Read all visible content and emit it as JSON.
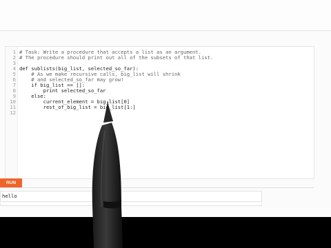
{
  "editor": {
    "lines": [
      {
        "n": "1",
        "text": "# Task: Write a procedure that accepts a list as an argument.",
        "comment": true
      },
      {
        "n": "2",
        "text": "# The procedure should print out all of the subsets of that list.",
        "comment": true
      },
      {
        "n": "3",
        "text": "",
        "comment": false
      },
      {
        "n": "4",
        "text": "def sublists(big_list, selected_so_far):",
        "comment": false
      },
      {
        "n": "5",
        "text": "    # As we make recursive calls, big_list will shrink",
        "comment": true
      },
      {
        "n": "6",
        "text": "    # and selected_so_far may grow!",
        "comment": true
      },
      {
        "n": "7",
        "text": "    if big_list == []:",
        "comment": false
      },
      {
        "n": "8",
        "text": "        print selected_so_far",
        "comment": false
      },
      {
        "n": "9",
        "text": "    else:",
        "comment": false
      },
      {
        "n": "10",
        "text": "        current_element = big_list[0]",
        "comment": false
      },
      {
        "n": "11",
        "text": "        rest_of_big_list = big_list[1:]",
        "comment": false
      },
      {
        "n": "12",
        "text": "",
        "comment": false
      }
    ]
  },
  "run_button": {
    "label": "RUN",
    "color": "#f0642a"
  },
  "output": {
    "text": "hello"
  }
}
